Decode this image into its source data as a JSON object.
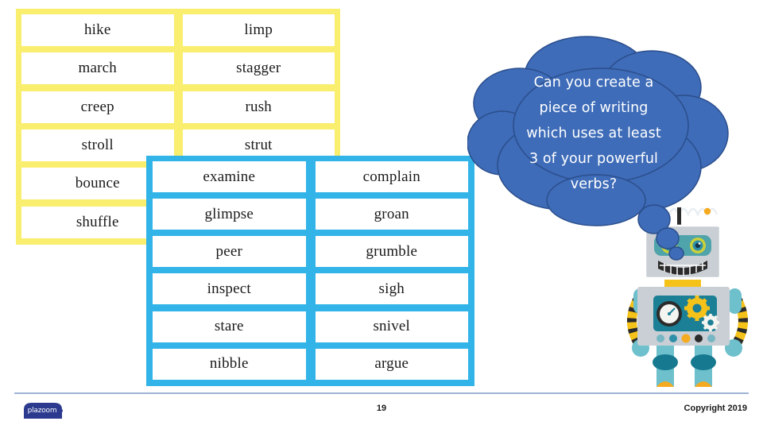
{
  "slide": {
    "background_color": "#ffffff"
  },
  "yellow_table": {
    "name": "movement-verbs-table",
    "border_color": "#faee6e",
    "cell_background": "#ffffff",
    "columns": 2,
    "rows": 6,
    "words": [
      [
        "hike",
        "limp"
      ],
      [
        "march",
        "stagger"
      ],
      [
        "creep",
        "rush"
      ],
      [
        "stroll",
        "strut"
      ],
      [
        "bounce",
        "shuffle"
      ],
      [
        "shuffle",
        ""
      ]
    ],
    "cells": [
      "hike",
      "limp",
      "march",
      "stagger",
      "creep",
      "rush",
      "stroll",
      "strut",
      "bounce",
      "",
      "shuffle",
      ""
    ]
  },
  "blue_table": {
    "name": "looking-and-sound-verbs-table",
    "border_color": "#32b4e8",
    "cell_background": "#ffffff",
    "columns": 2,
    "rows": 6,
    "cells": [
      "examine",
      "complain",
      "glimpse",
      "groan",
      "peer",
      "grumble",
      "inspect",
      "sigh",
      "stare",
      "snivel",
      "nibble",
      "argue"
    ]
  },
  "thought_bubble": {
    "fill_color": "#3e6cb8",
    "text_color": "#ffffff",
    "text": "Can you create a\npiece of writing\nwhich uses at least\n3 of your powerful\nverbs?"
  },
  "robot": {
    "head_color": "#c9cfd4",
    "body_color": "#c9cfd4",
    "panel_color": "#1b7f96",
    "limb_color": "#6dc0cc",
    "joint_color": "#16798f",
    "foot_color": "#f5ab21",
    "accent_yellow": "#f5c21a",
    "stripe_dark": "#2b2b2b",
    "eye_ring_color": "#cbd13a"
  },
  "footer": {
    "logo_text": "plazoom",
    "logo_color": "#2b3a8f",
    "page_number": "19",
    "copyright": "Copyright 2019",
    "rule_color": "#9fb4d6"
  }
}
